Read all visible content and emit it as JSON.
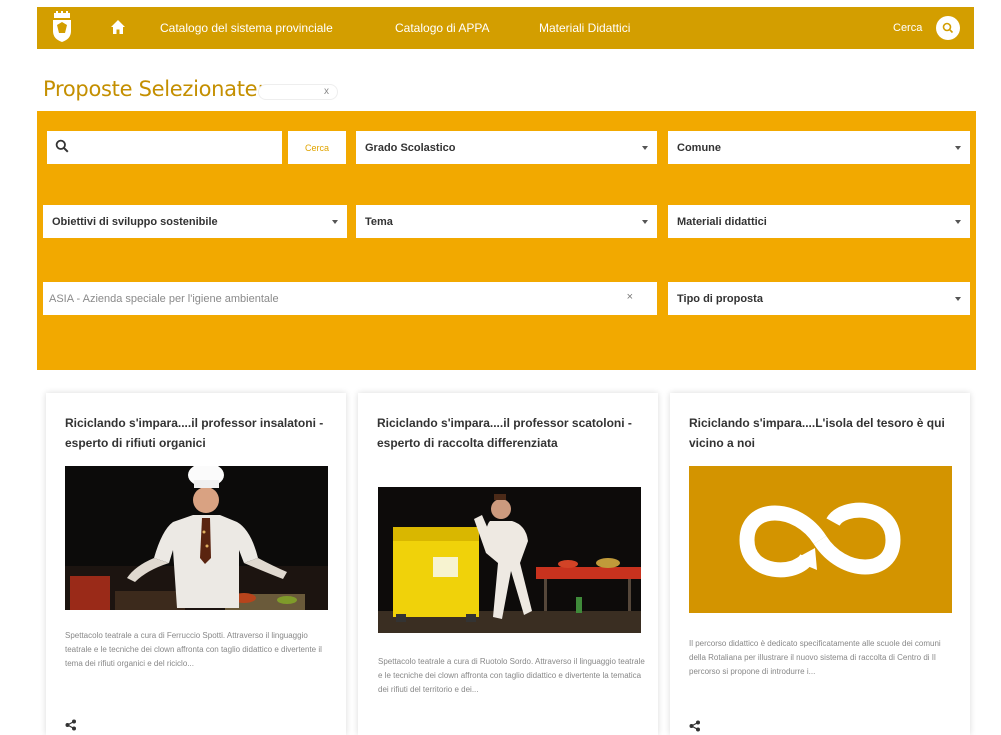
{
  "navbar": {
    "items": [
      {
        "label": "Catalogo del sistema provinciale",
        "active": true
      },
      {
        "label": "Catalogo di APPA",
        "active": false
      },
      {
        "label": "Materiali Didattici",
        "active": false
      }
    ],
    "search_label": "Cerca"
  },
  "heading": "Proposte Selezionate:",
  "chip": {
    "label": "x"
  },
  "filters": {
    "search_placeholder": "",
    "search_button": "Cerca",
    "grado": "Grado Scolastico",
    "comune": "Comune",
    "obiettivi": "Obiettivi di sviluppo sostenibile",
    "tema": "Tema",
    "materiali": "Materiali didattici",
    "ente": "ASIA - Azienda speciale per l'igiene ambientale",
    "ente_clear": "×",
    "tipo": "Tipo di proposta"
  },
  "cards": [
    {
      "title": "Riciclando s'impara....il professor insalatoni - esperto di rifiuti organici",
      "description": "Spettacolo teatrale a cura di Ferruccio Spotti. Attraverso il linguaggio teatrale e le tecniche dei clown affronta con taglio didattico e divertente il tema dei rifiuti organici e del riciclo..."
    },
    {
      "title": "Riciclando s'impara....il professor scatoloni - esperto di raccolta differenziata",
      "description": "Spettacolo teatrale a cura di Ruotolo Sordo. Attraverso il linguaggio teatrale e le tecniche dei clown affronta con taglio didattico e divertente la tematica dei rifiuti del territorio e dei..."
    },
    {
      "title": "Riciclando s'impara....L'isola del tesoro è qui vicino a noi",
      "description": "Il percorso didattico è dedicato specificatamente alle scuole dei comuni della Rotaliana per illustrare il nuovo sistema di raccolta di Centro di Il percorso si propone di introdurre i..."
    }
  ],
  "colors": {
    "navbar": "#d39e00",
    "filters": "#f2a900",
    "heading": "#c48f00",
    "accent_tile": "#d39400"
  }
}
